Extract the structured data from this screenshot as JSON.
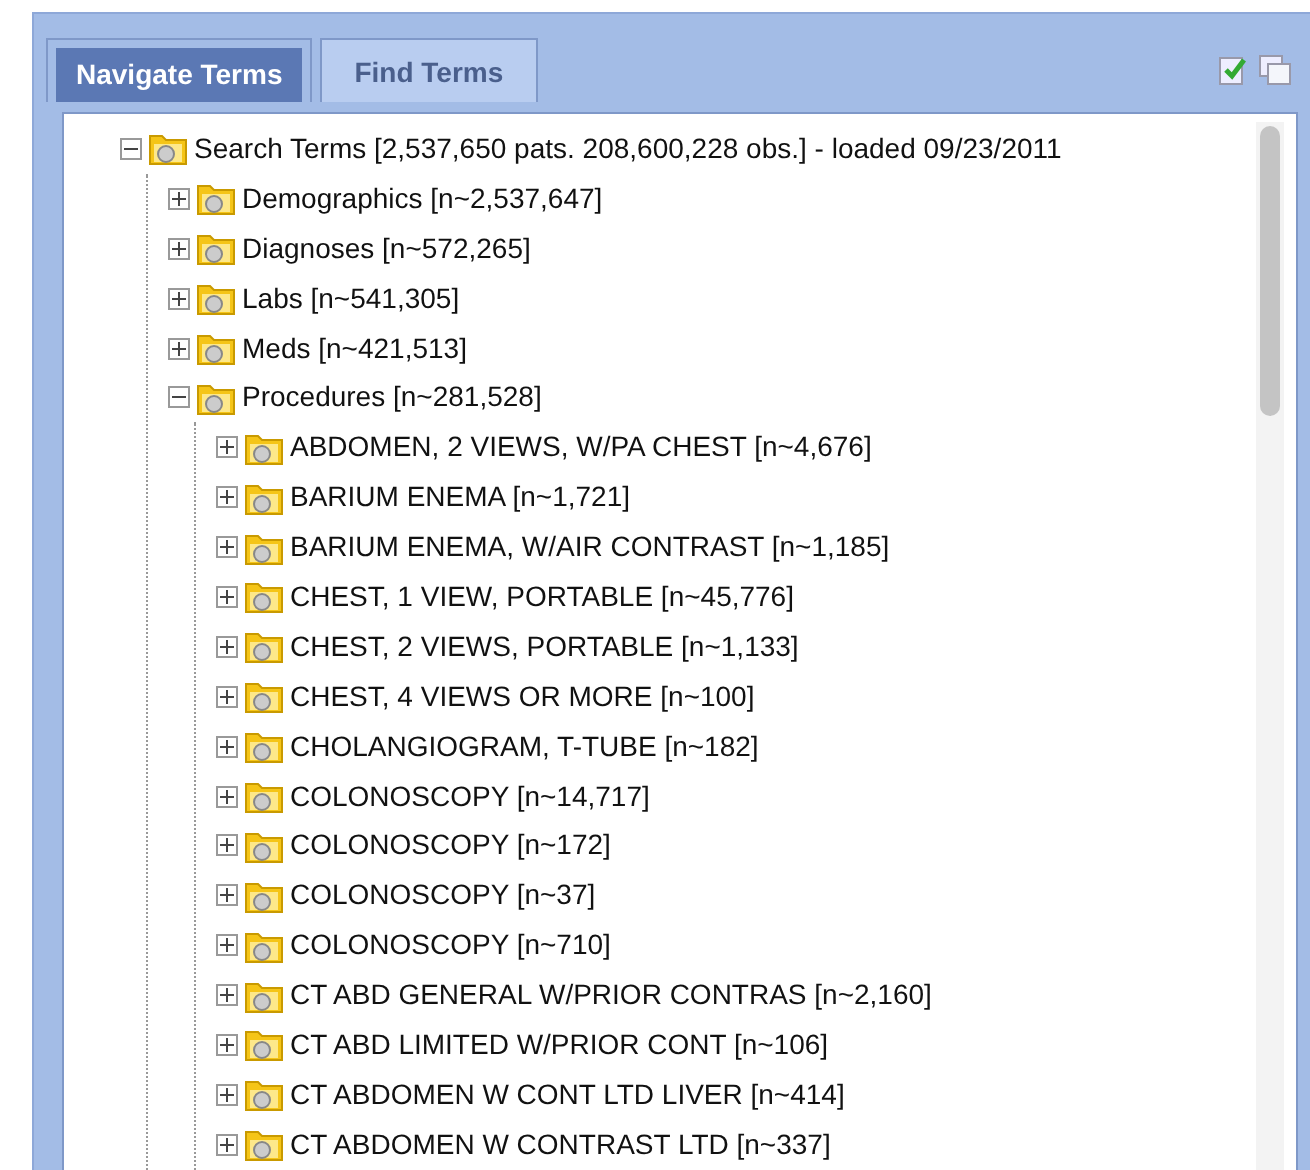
{
  "tabs": [
    {
      "label": "Navigate Terms",
      "selected": true
    },
    {
      "label": "Find Terms",
      "selected": false
    }
  ],
  "tree": [
    {
      "label": "Search Terms [2,537,650 pats. 208,600,228 obs.] - loaded 09/23/2011",
      "expanded": true,
      "children": [
        {
          "label": "Demographics [n~2,537,647]",
          "expanded": false
        },
        {
          "label": "Diagnoses [n~572,265]",
          "expanded": false
        },
        {
          "label": "Labs [n~541,305]",
          "expanded": false
        },
        {
          "label": "Meds [n~421,513]",
          "expanded": false
        },
        {
          "label": "Procedures [n~281,528]",
          "expanded": true,
          "children": [
            {
              "label": "ABDOMEN, 2 VIEWS, W/PA CHEST [n~4,676]",
              "expanded": false
            },
            {
              "label": "BARIUM ENEMA [n~1,721]",
              "expanded": false
            },
            {
              "label": "BARIUM ENEMA, W/AIR CONTRAST [n~1,185]",
              "expanded": false
            },
            {
              "label": "CHEST, 1 VIEW, PORTABLE [n~45,776]",
              "expanded": false
            },
            {
              "label": "CHEST, 2 VIEWS, PORTABLE [n~1,133]",
              "expanded": false
            },
            {
              "label": "CHEST, 4 VIEWS OR MORE [n~100]",
              "expanded": false
            },
            {
              "label": "CHOLANGIOGRAM, T-TUBE [n~182]",
              "expanded": false
            },
            {
              "label": "COLONOSCOPY [n~14,717]",
              "expanded": false
            },
            {
              "label": "COLONOSCOPY [n~172]",
              "expanded": false
            },
            {
              "label": "COLONOSCOPY [n~37]",
              "expanded": false
            },
            {
              "label": "COLONOSCOPY [n~710]",
              "expanded": false
            },
            {
              "label": "CT ABD GENERAL W/PRIOR CONTRAS [n~2,160]",
              "expanded": false
            },
            {
              "label": "CT ABD LIMITED W/PRIOR CONT [n~106]",
              "expanded": false
            },
            {
              "label": "CT ABDOMEN W CONT LTD LIVER [n~414]",
              "expanded": false
            },
            {
              "label": "CT ABDOMEN W CONTRAST LTD [n~337]",
              "expanded": false
            }
          ]
        }
      ]
    }
  ]
}
